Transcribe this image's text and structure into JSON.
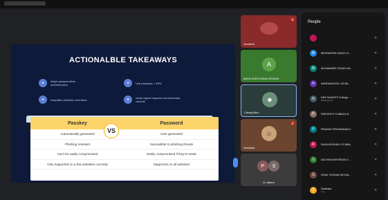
{
  "slide": {
    "title": "ACTIONALBLE TAKEAWAYS",
    "takeaways": [
      {
        "text": "Adopt passwordless authentication"
      },
      {
        "text": "Use passkeys + MFA"
      },
      {
        "text": "Deepfake detection heuristics"
      },
      {
        "text": "verify urgent requests via secondary channel"
      }
    ],
    "comparison": {
      "headers": [
        "Passkey",
        "Password"
      ],
      "vs": "VS",
      "rows": [
        [
          "Automatically generated",
          "User generated"
        ],
        [
          "Phishing resistant",
          "Susceptible to phishing threats"
        ],
        [
          "Can't be easily compromised",
          "Easily compromised if they're weak"
        ],
        [
          "Only supported on a few websites currently",
          "Supported on all websites"
        ]
      ]
    }
  },
  "tiles": [
    {
      "name": "Swakesh"
    },
    {
      "name": "MAYA KHEDIYANA JEONAS",
      "initial": "A"
    },
    {
      "name": "Christy Binu"
    },
    {
      "name": "Swathika"
    },
    {
      "name": "21 others",
      "initials": [
        "P",
        "S"
      ]
    }
  ],
  "people": {
    "title": "People",
    "list": [
      {
        "name": "",
        "initial": "",
        "color": "#c2185b"
      },
      {
        "name": "MEENAKSHI MANOJ K...",
        "initial": "M",
        "color": "#1e88e5"
      },
      {
        "name": "MUHAMMED FAZAN NA...",
        "initial": "M",
        "color": "#00897b"
      },
      {
        "name": "NANDANA MOL XN 86...",
        "initial": "N",
        "color": "#5e35b1"
      },
      {
        "name": "NSS SANGITS College ...",
        "sub": "Meeting host",
        "initial": "N",
        "color": "#455a64"
      },
      {
        "name": "PARVATHY S BBA24-3I",
        "initial": "P",
        "color": "#8d6e63"
      },
      {
        "name": "PRANAV PRASANNAKU...",
        "initial": "P",
        "color": "#00838f"
      },
      {
        "name": "RAJALEKSHMI K R BBA...",
        "initial": "R",
        "color": "#c2185b"
      },
      {
        "name": "SACHIN MATHEEAN S...",
        "initial": "S",
        "color": "#2e7d32"
      },
      {
        "name": "SONII THOMAS BCOM...",
        "initial": "S",
        "color": "#6d4c41"
      },
      {
        "name": "Swathika",
        "sub": "You",
        "initial": "S",
        "color": "#f9a825"
      }
    ]
  },
  "colors": {
    "accent": "#8ab4f8",
    "table_header": "#fcd46a",
    "slide_bg": "#0e1a3a"
  }
}
